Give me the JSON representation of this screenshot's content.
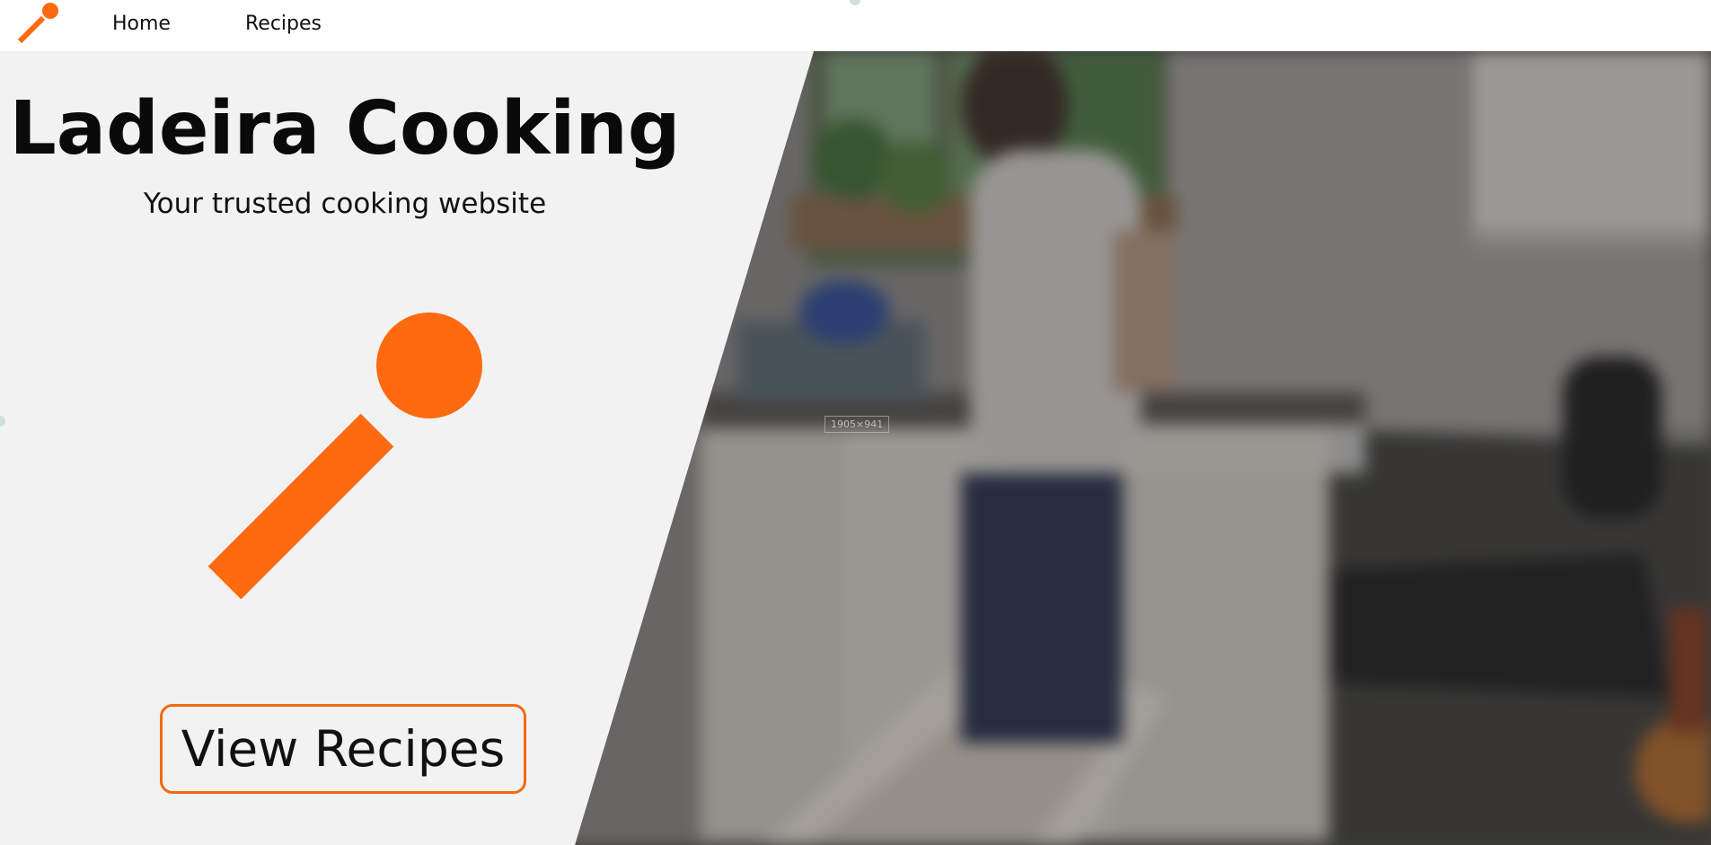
{
  "nav": {
    "logo_icon": "spoon-icon",
    "home_label": "Home",
    "recipes_label": "Recipes"
  },
  "hero": {
    "title": "Ladeira Cooking",
    "subtitle": "Your trusted cooking website",
    "logo_icon": "spoon-icon",
    "cta_label": "View Recipes",
    "background_image": "blurred kitchen photo with a person at the sink"
  },
  "overlay": {
    "dimension_label": "1905×941"
  },
  "colors": {
    "accent": "#ff6a10",
    "panel_background": "#f2f2f2",
    "navbar_background": "#ffffff",
    "text": "#0a0a0a"
  }
}
